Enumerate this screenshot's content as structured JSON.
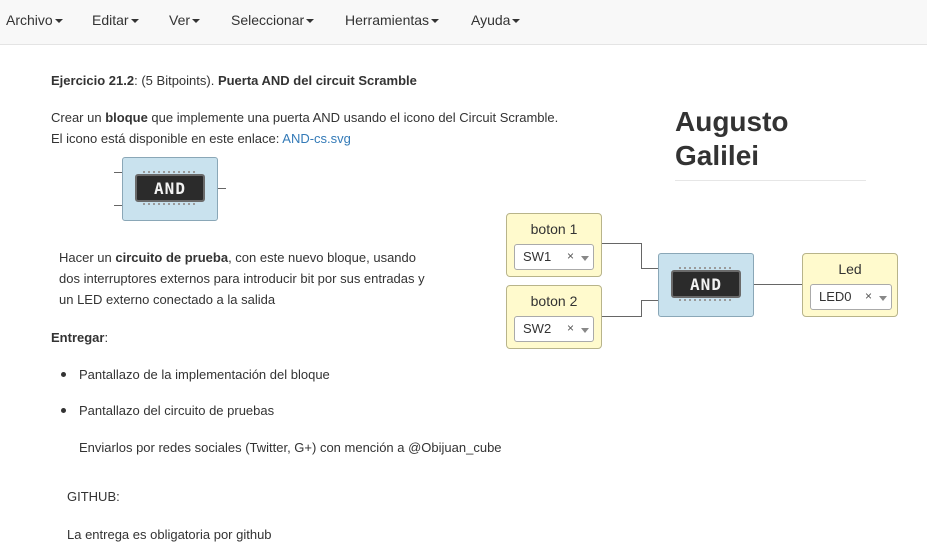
{
  "menu": {
    "items": [
      "Archivo",
      "Editar",
      "Ver",
      "Seleccionar",
      "Herramientas",
      "Ayuda"
    ]
  },
  "exercise": {
    "title_prefix": "Ejercicio 21.2",
    "title_points": ": (5 Bitpoints). ",
    "title_main": "Puerta AND del circuit Scramble",
    "p1_a": "Crear un ",
    "p1_b": "bloque",
    "p1_c": " que implemente una puerta AND usando el icono del Circuit Scramble.",
    "p2_a": "El icono está disponible en este enlace: ",
    "p2_link": "AND-cs.svg",
    "p3_a": "Hacer un ",
    "p3_b": "circuito de prueba",
    "p3_c": ", con este nuevo bloque, usando",
    "p3_line2": "dos interruptores externos para introducir bit por sus entradas y",
    "p3_line3": "un LED externo conectado a la salida",
    "deliver_label": "Entregar",
    "deliver_colon": ":",
    "bullet1": "Pantallazo de la implementación del bloque",
    "bullet2": "Pantallazo del circuito de pruebas",
    "send_note": "Enviarlos por redes sociales (Twitter, G+) con mención a @Obijuan_cube",
    "github_label": "GITHUB:",
    "github_note": "La entrega es obligatoria por github"
  },
  "author": {
    "first": "Augusto",
    "last": "Galilei"
  },
  "circuit": {
    "and_label": "AND",
    "input1": {
      "title": "boton 1",
      "value": "SW1",
      "clear": "×"
    },
    "input2": {
      "title": "boton 2",
      "value": "SW2",
      "clear": "×"
    },
    "output": {
      "title": "Led",
      "value": "LED0",
      "clear": "×"
    }
  },
  "colors": {
    "io_block": "#fffacd",
    "and_block": "#c9e2ee",
    "link": "#337ab7"
  }
}
